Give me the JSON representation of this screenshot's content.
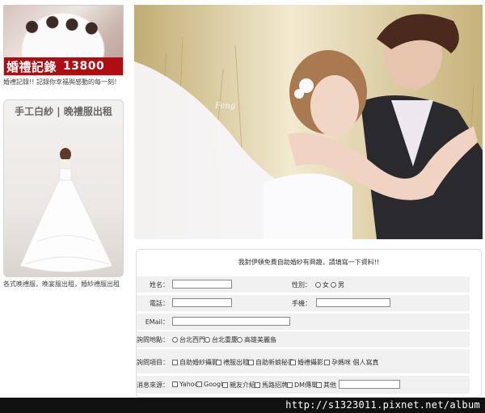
{
  "promo": {
    "title": "婚禮記錄",
    "price": "13800",
    "caption": "婚禮記錄!! 記錄你幸福與感動的每一刻！"
  },
  "dress": {
    "title": "手工白紗 | 晚禮服出租",
    "caption": "各式晚禮服，晚宴服出租，婚紗禮服出租"
  },
  "hero": {
    "watermark": "Feng"
  },
  "form": {
    "title": "我對伊頓免費自助婚紗有興趣，請填寫一下資料!!",
    "name_label": "姓名：",
    "gender_label": "性別：",
    "gender_options": [
      "女",
      "男"
    ],
    "phone_label": "電話：",
    "mobile_label": "手機：",
    "email_label": "EMail：",
    "location_label": "詢問地點：",
    "location_options": [
      "台北西門",
      "台北重慶",
      "高雄美麗島"
    ],
    "items_label": "詢問項目：",
    "items_options": [
      "自助婚紗攝影",
      "禮服出租",
      "自助新娘秘書",
      "婚禮攝影",
      "孕媽咪 個人寫真"
    ],
    "source_label": "消息來源：",
    "source_options": [
      "Yahoo",
      "Google",
      "親友介紹",
      "馬路招牌",
      "DM傳單",
      "其他"
    ]
  },
  "url": "http://s1323011.pixnet.net/album"
}
